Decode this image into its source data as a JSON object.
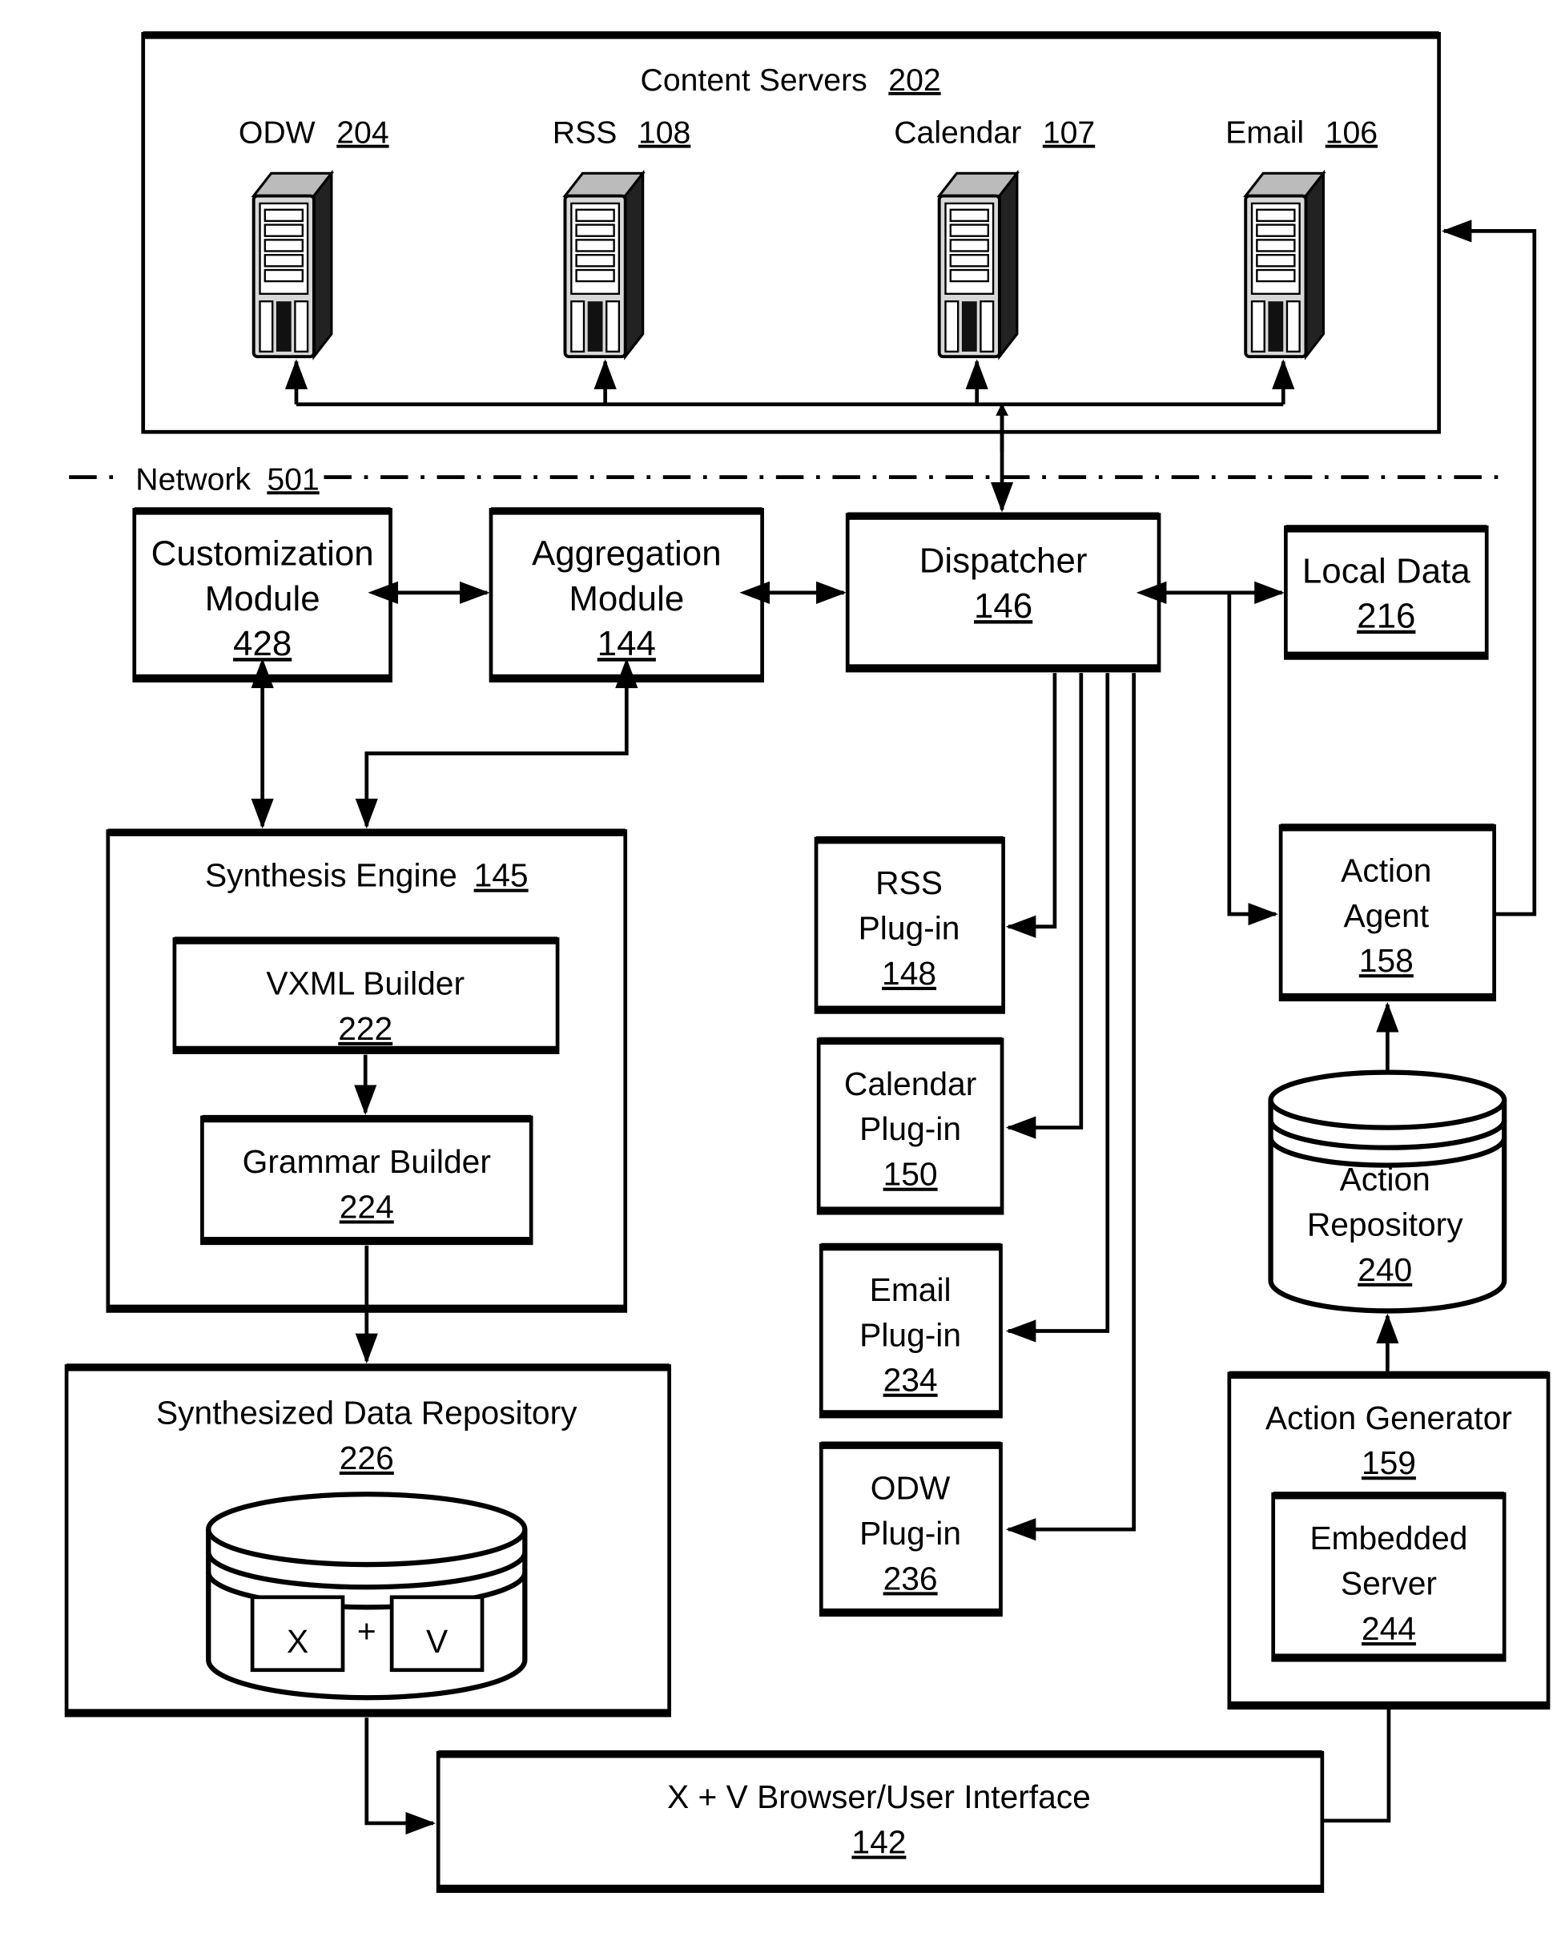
{
  "diagram": {
    "content_servers": {
      "title": "Content Servers",
      "ref": "202",
      "servers": [
        {
          "name": "ODW",
          "ref": "204",
          "icon": "server-tower-icon"
        },
        {
          "name": "RSS",
          "ref": "108",
          "icon": "server-tower-icon"
        },
        {
          "name": "Calendar",
          "ref": "107",
          "icon": "server-tower-icon"
        },
        {
          "name": "Email",
          "ref": "106",
          "icon": "server-tower-icon"
        }
      ]
    },
    "network": {
      "label": "Network",
      "ref": "501"
    },
    "customization_module": {
      "line1": "Customization",
      "line2": "Module",
      "ref": "428"
    },
    "aggregation_module": {
      "line1": "Aggregation",
      "line2": "Module",
      "ref": "144"
    },
    "dispatcher": {
      "line1": "Dispatcher",
      "ref": "146"
    },
    "local_data": {
      "line1": "Local Data",
      "ref": "216"
    },
    "synthesis_engine": {
      "title": "Synthesis Engine",
      "ref": "145",
      "vxml_builder": {
        "line1": "VXML Builder",
        "ref": "222"
      },
      "grammar_builder": {
        "line1": "Grammar Builder",
        "ref": "224"
      }
    },
    "plugins": [
      {
        "line1": "RSS",
        "line2": "Plug-in",
        "ref": "148"
      },
      {
        "line1": "Calendar",
        "line2": "Plug-in",
        "ref": "150"
      },
      {
        "line1": "Email",
        "line2": "Plug-in",
        "ref": "234"
      },
      {
        "line1": "ODW",
        "line2": "Plug-in",
        "ref": "236"
      }
    ],
    "action_agent": {
      "line1": "Action",
      "line2": "Agent",
      "ref": "158"
    },
    "action_repository": {
      "line1": "Action",
      "line2": "Repository",
      "ref": "240"
    },
    "action_generator": {
      "title": "Action Generator",
      "ref": "159",
      "embedded_server": {
        "line1": "Embedded",
        "line2": "Server",
        "ref": "244"
      }
    },
    "synthesized_data_repository": {
      "title": "Synthesized Data Repository",
      "ref": "226",
      "x_label": "X",
      "plus": "+",
      "v_label": "V"
    },
    "browser": {
      "line1": "X + V Browser/User Interface",
      "ref": "142"
    }
  }
}
